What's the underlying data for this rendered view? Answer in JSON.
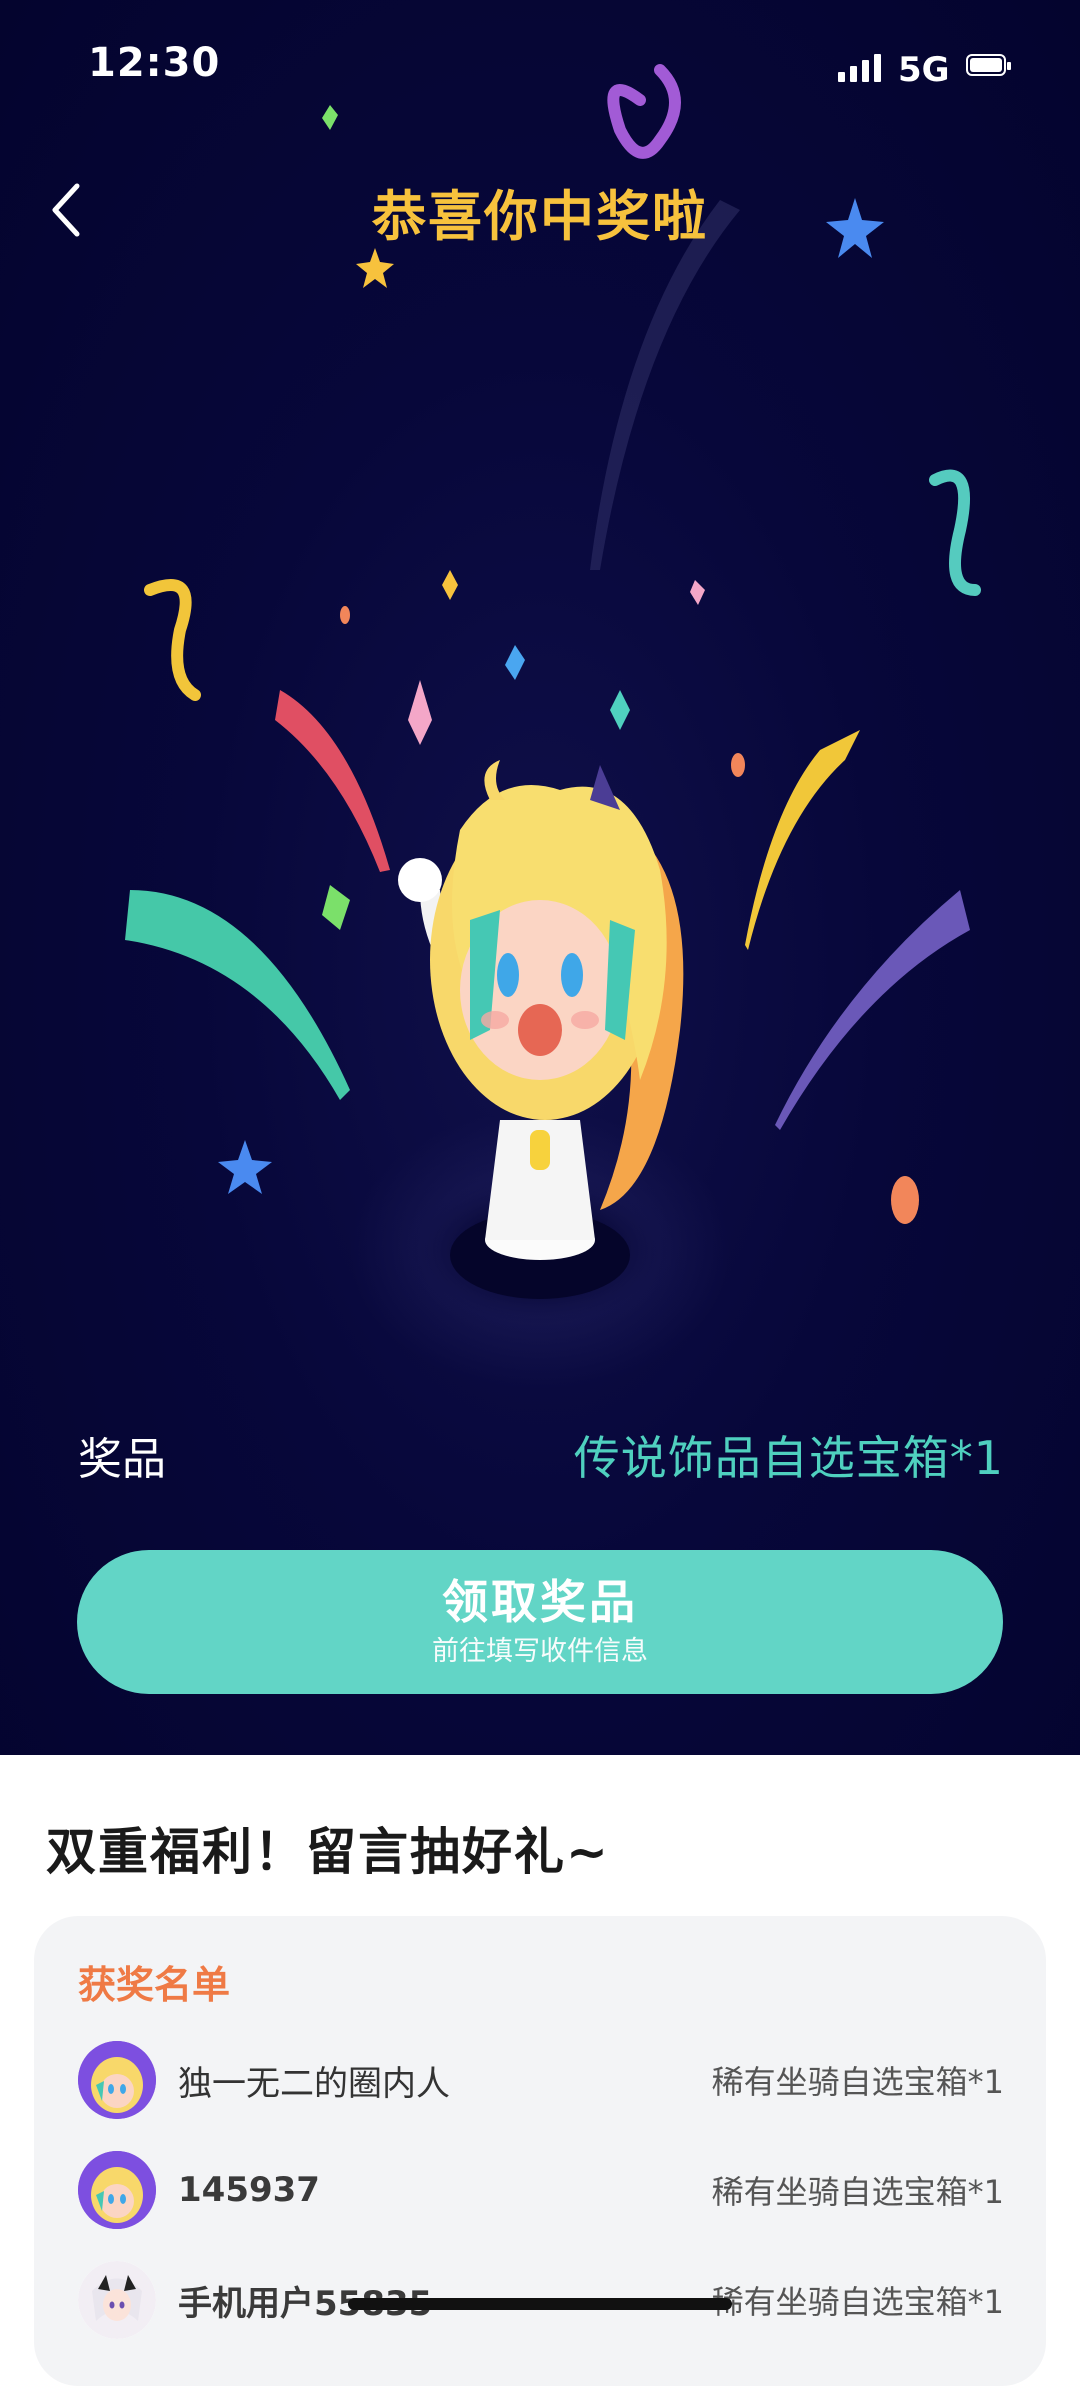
{
  "status": {
    "time": "12:30",
    "network": "5G",
    "signal_bars": 4,
    "battery_level": 1.0
  },
  "nav": {
    "back_icon": "chevron-left-icon",
    "title": "恭喜你中奖啦"
  },
  "prize": {
    "label": "奖品",
    "value": "传说饰品自选宝箱*1"
  },
  "claim_button": {
    "main": "领取奖品",
    "sub": "前往填写收件信息"
  },
  "section": {
    "title": "双重福利！留言抽好礼~"
  },
  "winners": {
    "heading": "获奖名单",
    "items": [
      {
        "name": "独一无二的圈内人",
        "prize": "稀有坐骑自选宝箱*1",
        "avatar": "mascot-avatar"
      },
      {
        "name": "145937",
        "prize": "稀有坐骑自选宝箱*1",
        "avatar": "mascot-avatar"
      },
      {
        "name": "手机用户55835",
        "prize": "稀有坐骑自选宝箱*1",
        "avatar": "anime-avatar"
      }
    ]
  },
  "colors": {
    "hero_bg": "#07073a",
    "title": "#f7c23d",
    "accent": "#62d5c6",
    "prize_value": "#4fd0bf",
    "winners_heading": "#ef7a45"
  }
}
